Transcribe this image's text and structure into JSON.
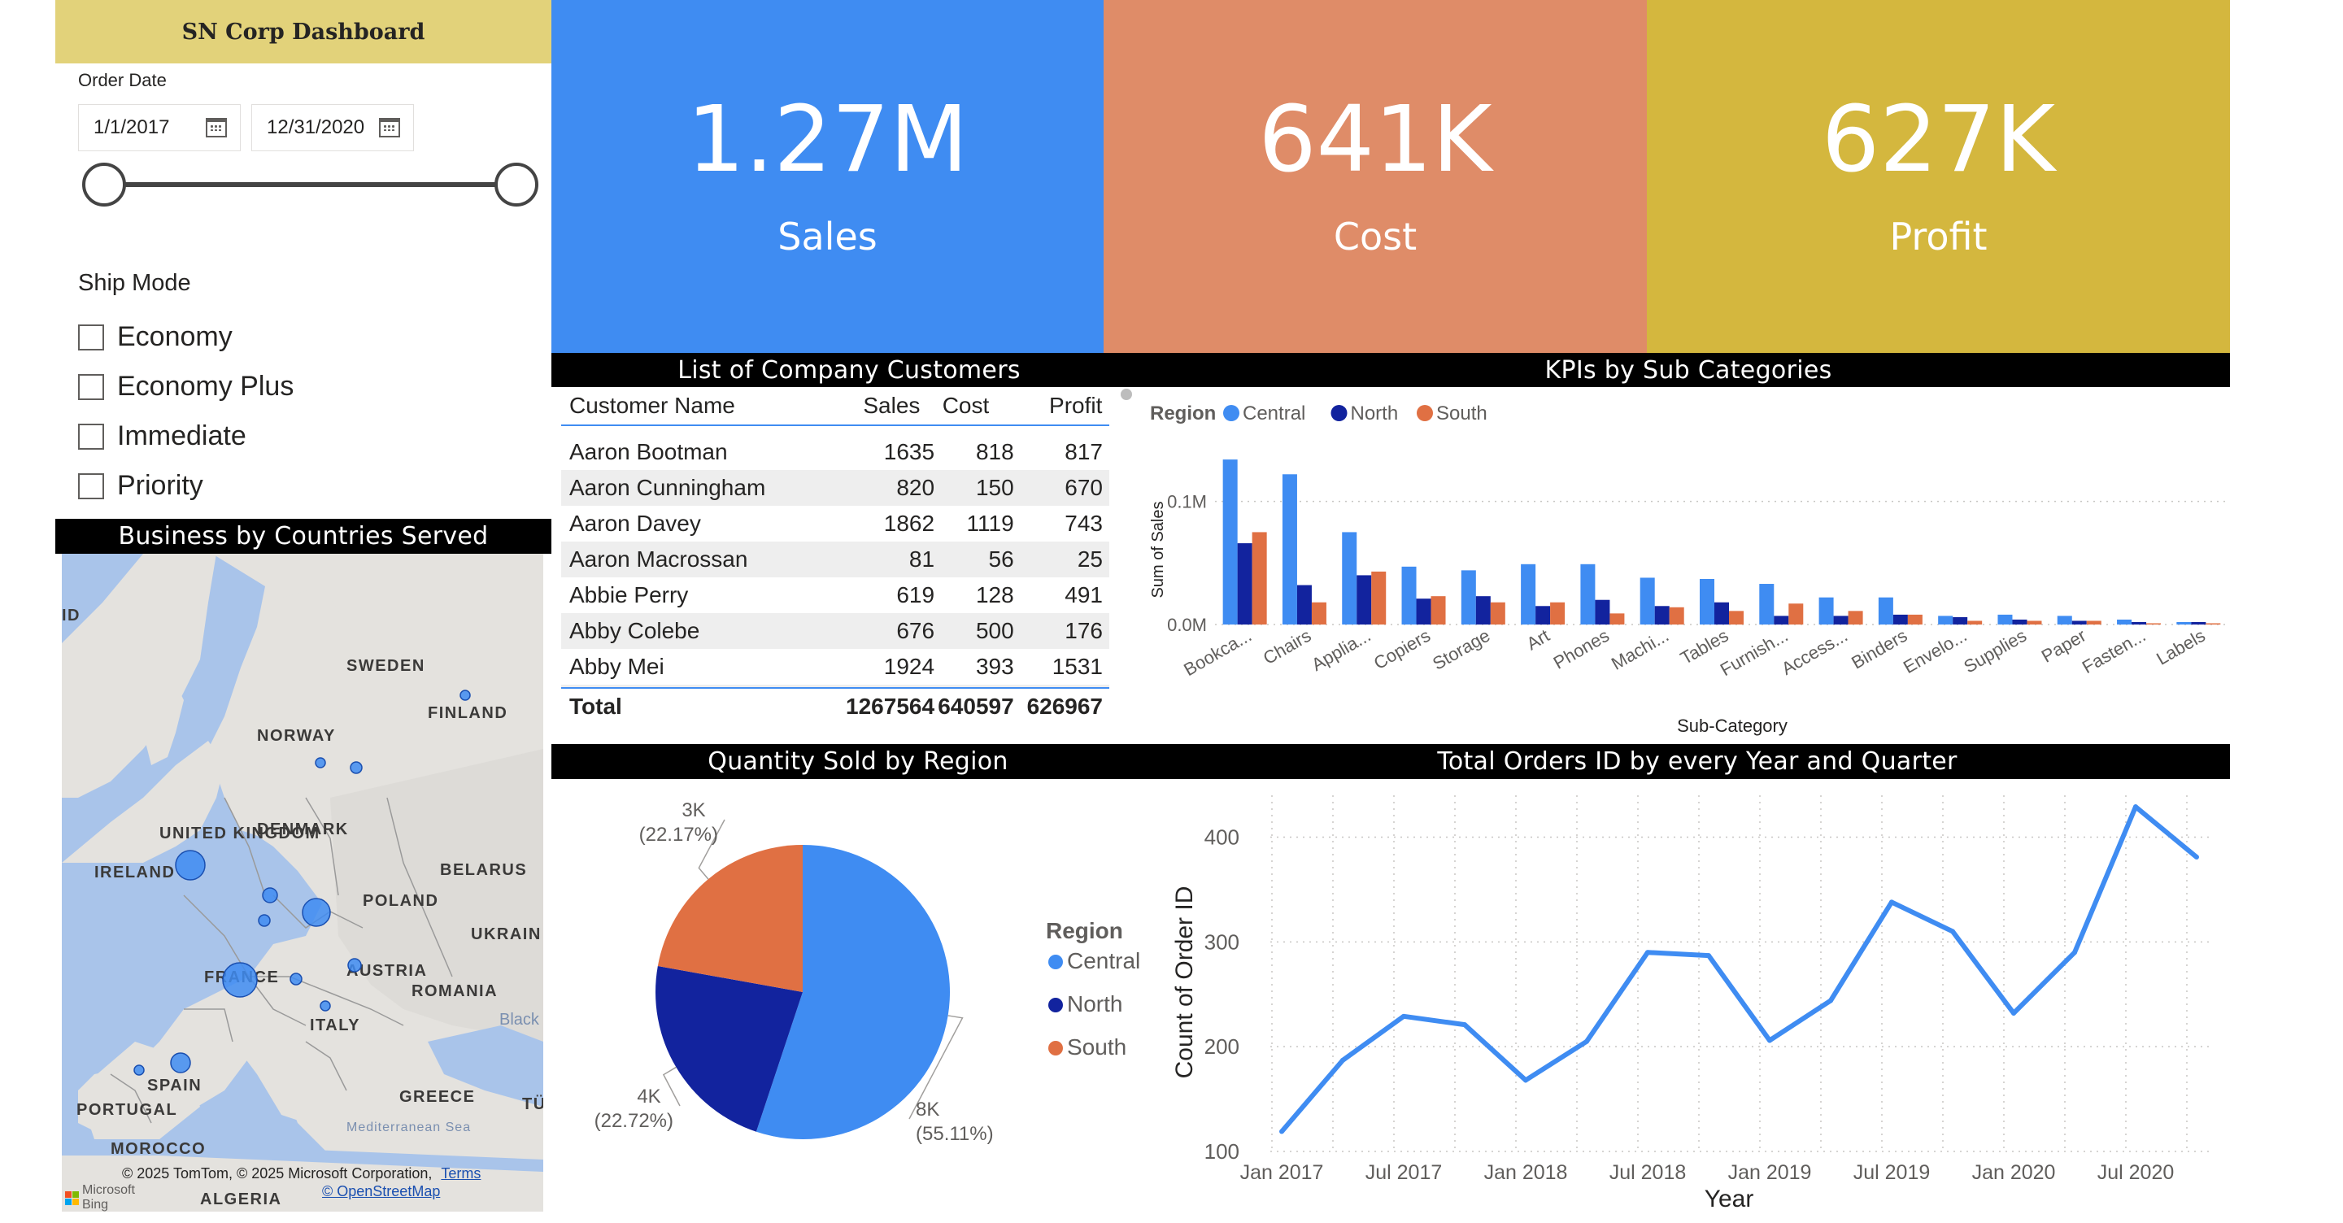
{
  "dashboard": {
    "title": "SN Corp Dashboard"
  },
  "filters": {
    "order_date_label": "Order Date",
    "start_date": "1/1/2017",
    "end_date": "12/31/2020",
    "ship_mode_label": "Ship Mode",
    "ship_modes": [
      {
        "label": "Economy",
        "checked": false
      },
      {
        "label": "Economy Plus",
        "checked": false
      },
      {
        "label": "Immediate",
        "checked": false
      },
      {
        "label": "Priority",
        "checked": false
      }
    ]
  },
  "kpis": [
    {
      "value": "1.27M",
      "label": "Sales",
      "color": "#3f8cf2"
    },
    {
      "value": "641K",
      "label": "Cost",
      "color": "#df8c68"
    },
    {
      "value": "627K",
      "label": "Profit",
      "color": "#d4b73e"
    }
  ],
  "customers": {
    "title": "List of Company Customers",
    "columns": [
      "Customer Name",
      "Sales",
      "Cost",
      "Profit"
    ],
    "rows": [
      [
        "Aaron Bootman",
        "1635",
        "818",
        "817"
      ],
      [
        "Aaron Cunningham",
        "820",
        "150",
        "670"
      ],
      [
        "Aaron Davey",
        "1862",
        "1119",
        "743"
      ],
      [
        "Aaron Macrossan",
        "81",
        "56",
        "25"
      ],
      [
        "Abbie Perry",
        "619",
        "128",
        "491"
      ],
      [
        "Abby Colebe",
        "676",
        "500",
        "176"
      ],
      [
        "Abby Mei",
        "1924",
        "393",
        "1531"
      ]
    ],
    "total": [
      "Total",
      "1267564",
      "640597",
      "626967"
    ]
  },
  "map": {
    "title": "Business by Countries Served",
    "labels": [
      "SWEDEN",
      "FINLAND",
      "NORWAY",
      "UNITED KINGDOM",
      "DENMARK",
      "IRELAND",
      "BELARUS",
      "POLAND",
      "UKRAIN",
      "FRANCE",
      "AUSTRIA",
      "ROMANIA",
      "ITALY",
      "SPAIN",
      "PORTUGAL",
      "GREECE",
      "MOROCCO",
      "ALGERIA",
      "Black",
      "Mediterranean Sea",
      "TÜ",
      "ID"
    ],
    "attribution": "© 2025 TomTom, © 2025 Microsoft Corporation,",
    "terms_link": "Terms",
    "osm_link": "© OpenStreetMap",
    "bing_label": "Microsoft Bing",
    "bubble_color": "#3f8cf2"
  },
  "kpi_chart": {
    "title": "KPIs by Sub Categories",
    "legend_title": "Region",
    "chart_data": {
      "type": "bar",
      "categories": [
        "Bookca...",
        "Chairs",
        "Applia...",
        "Copiers",
        "Storage",
        "Art",
        "Phones",
        "Machi...",
        "Tables",
        "Furnish...",
        "Access...",
        "Binders",
        "Envelo...",
        "Supplies",
        "Paper",
        "Fasten...",
        "Labels"
      ],
      "series": [
        {
          "name": "Central",
          "color": "#3f8cf2",
          "values": [
            0.134,
            0.122,
            0.075,
            0.047,
            0.044,
            0.049,
            0.049,
            0.038,
            0.037,
            0.033,
            0.022,
            0.022,
            0.007,
            0.008,
            0.007,
            0.004,
            0.002
          ]
        },
        {
          "name": "North",
          "color": "#12239e",
          "values": [
            0.066,
            0.032,
            0.04,
            0.021,
            0.023,
            0.015,
            0.02,
            0.015,
            0.018,
            0.007,
            0.007,
            0.008,
            0.006,
            0.004,
            0.003,
            0.002,
            0.002
          ]
        },
        {
          "name": "South",
          "color": "#e07043",
          "values": [
            0.075,
            0.018,
            0.043,
            0.023,
            0.018,
            0.018,
            0.009,
            0.014,
            0.011,
            0.017,
            0.011,
            0.008,
            0.003,
            0.003,
            0.003,
            0.001,
            0.001
          ]
        }
      ],
      "xlabel": "Sub-Category",
      "ylabel": "Sum of Sales",
      "yticks": [
        "0.0M",
        "0.1M"
      ],
      "ylim": [
        0,
        0.14
      ]
    }
  },
  "pie_chart": {
    "title": "Quantity Sold by Region",
    "legend_title": "Region",
    "chart_data": {
      "type": "pie",
      "slices": [
        {
          "name": "Central",
          "value": 55.11,
          "label": "8K",
          "pct": "(55.11%)",
          "color": "#3f8cf2"
        },
        {
          "name": "North",
          "value": 22.72,
          "label": "4K",
          "pct": "(22.72%)",
          "color": "#12239e"
        },
        {
          "name": "South",
          "value": 22.17,
          "label": "3K",
          "pct": "(22.17%)",
          "color": "#e07043"
        }
      ]
    }
  },
  "line_chart": {
    "title": "Total Orders ID by every Year and Quarter",
    "chart_data": {
      "type": "line",
      "x": [
        "2017 Q1",
        "2017 Q2",
        "2017 Q3",
        "2017 Q4",
        "2018 Q1",
        "2018 Q2",
        "2018 Q3",
        "2018 Q4",
        "2019 Q1",
        "2019 Q2",
        "2019 Q3",
        "2019 Q4",
        "2020 Q1",
        "2020 Q2",
        "2020 Q3",
        "2020 Q4"
      ],
      "values": [
        119,
        187,
        229,
        221,
        168,
        205,
        290,
        287,
        206,
        244,
        338,
        310,
        232,
        290,
        429,
        381
      ],
      "xticks": [
        "Jan 2017",
        "Jul 2017",
        "Jan 2018",
        "Jul 2018",
        "Jan 2019",
        "Jul 2019",
        "Jan 2020",
        "Jul 2020"
      ],
      "yticks": [
        "100",
        "200",
        "300",
        "400"
      ],
      "ylim": [
        100,
        440
      ],
      "xlabel": "Year",
      "ylabel": "Count of Order ID",
      "color": "#3f8cf2"
    }
  }
}
